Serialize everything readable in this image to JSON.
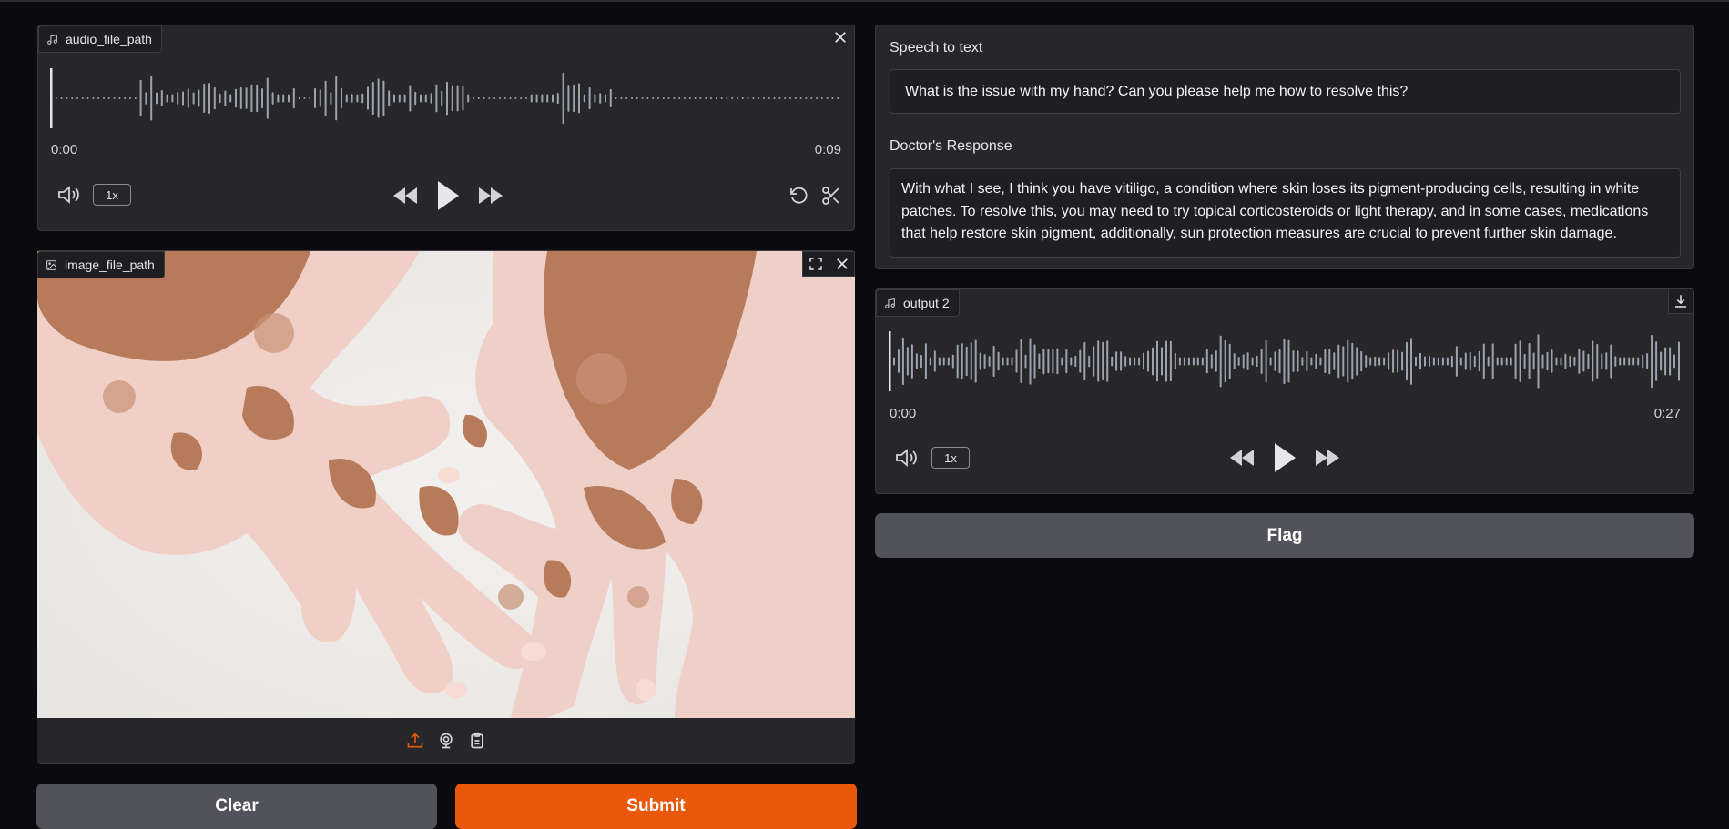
{
  "audio_input": {
    "label": "audio_file_path",
    "current_time": "0:00",
    "duration": "0:09",
    "speed": "1x",
    "icons": [
      "music-note-icon",
      "close-icon",
      "volume-icon",
      "rewind-icon",
      "play-icon",
      "fast-forward-icon",
      "undo-icon",
      "scissors-icon"
    ]
  },
  "image_input": {
    "label": "image_file_path",
    "icons": [
      "image-icon",
      "fullscreen-icon",
      "close-icon",
      "upload-icon",
      "webcam-icon",
      "clipboard-icon"
    ],
    "upload_accent": "#ea580c"
  },
  "buttons": {
    "clear": "Clear",
    "submit": "Submit",
    "flag": "Flag"
  },
  "speech_to_text": {
    "label": "Speech to text",
    "value": "What is the issue with my hand? Can you please help me how to resolve this?"
  },
  "doctor_response": {
    "label": "Doctor's Response",
    "value": "With what I see, I think you have vitiligo, a condition where skin loses its pigment-producing cells, resulting in white patches. To resolve this, you may need to try topical corticosteroids or light therapy, and in some cases, medications that help restore skin pigment, additionally, sun protection measures are crucial to prevent further skin damage."
  },
  "audio_output": {
    "label": "output 2",
    "current_time": "0:00",
    "duration": "0:27",
    "speed": "1x",
    "icons": [
      "music-note-icon",
      "download-icon",
      "volume-icon",
      "rewind-icon",
      "play-icon",
      "fast-forward-icon"
    ]
  },
  "colors": {
    "background": "#0b0b0f",
    "panel": "#27272a",
    "primary": "#ea580c",
    "secondary": "#52525b",
    "waveform": "#9ca3af"
  }
}
